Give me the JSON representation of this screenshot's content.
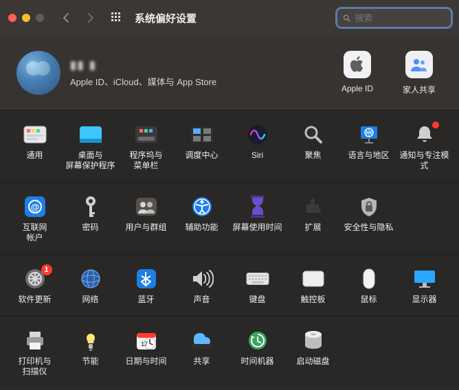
{
  "window": {
    "title": "系统偏好设置",
    "search_placeholder": "搜索"
  },
  "account": {
    "display_name": "▮▮ ▮",
    "subtitle": "Apple ID、iCloud、媒体与 App Store",
    "right": [
      {
        "id": "apple-id",
        "label": "Apple ID"
      },
      {
        "id": "family-sharing",
        "label": "家人共享"
      }
    ]
  },
  "sections": [
    {
      "items": [
        {
          "id": "general",
          "label": "通用"
        },
        {
          "id": "desktop",
          "label": "桌面与\n屏幕保护程序"
        },
        {
          "id": "dock",
          "label": "程序坞与\n菜单栏"
        },
        {
          "id": "mission-control",
          "label": "调度中心"
        },
        {
          "id": "siri",
          "label": "Siri"
        },
        {
          "id": "spotlight",
          "label": "聚焦"
        },
        {
          "id": "language",
          "label": "语言与地区"
        },
        {
          "id": "notifications",
          "label": "通知与专注模式",
          "dot": true
        }
      ]
    },
    {
      "items": [
        {
          "id": "internet-accounts",
          "label": "互联网\n帐户"
        },
        {
          "id": "passwords",
          "label": "密码"
        },
        {
          "id": "users-groups",
          "label": "用户与群组"
        },
        {
          "id": "accessibility",
          "label": "辅助功能"
        },
        {
          "id": "screen-time",
          "label": "屏幕使用时间"
        },
        {
          "id": "extensions",
          "label": "扩展"
        },
        {
          "id": "security",
          "label": "安全性与隐私"
        }
      ]
    },
    {
      "items": [
        {
          "id": "software-update",
          "label": "软件更新",
          "badge": "1"
        },
        {
          "id": "network",
          "label": "网络"
        },
        {
          "id": "bluetooth",
          "label": "蓝牙"
        },
        {
          "id": "sound",
          "label": "声音"
        },
        {
          "id": "keyboard",
          "label": "键盘"
        },
        {
          "id": "trackpad",
          "label": "触控板"
        },
        {
          "id": "mouse",
          "label": "鼠标"
        },
        {
          "id": "displays",
          "label": "显示器"
        }
      ]
    },
    {
      "items": [
        {
          "id": "printers",
          "label": "打印机与\n扫描仪"
        },
        {
          "id": "energy",
          "label": "节能"
        },
        {
          "id": "date-time",
          "label": "日期与时间"
        },
        {
          "id": "sharing",
          "label": "共享"
        },
        {
          "id": "time-machine",
          "label": "时间机器"
        },
        {
          "id": "startup-disk",
          "label": "启动磁盘"
        }
      ]
    }
  ]
}
